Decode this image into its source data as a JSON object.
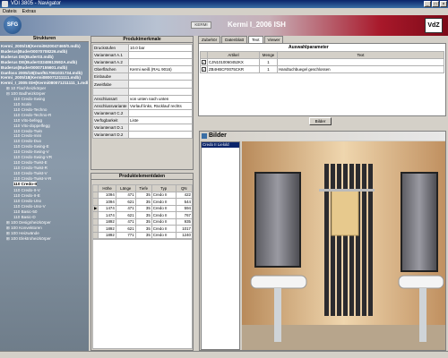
{
  "window": {
    "title": "VDI 3805 - Navigator",
    "controls": [
      "_",
      "□",
      "×"
    ]
  },
  "menu": [
    "Dateis",
    "Extras"
  ],
  "header": {
    "badge": "KERMI",
    "title": "Kermi I_2006 ISH",
    "vdi_logo": "VdZ",
    "logo_text": "SFG"
  },
  "tree": {
    "heading": "Strukturen",
    "items": [
      {
        "label": "Kermi_2005/18(Kermi0620047460/0.mdb)",
        "bold": true
      },
      {
        "label": "Buderus(Buder00070708226.mdb)",
        "bold": true
      },
      {
        "label": "Buderus DE(Buder03.mdb)",
        "bold": true
      },
      {
        "label": "Buderus DE(Buder03248613592A.mdb)",
        "bold": true
      },
      {
        "label": "Buderus(Buder00007155601.mdb)",
        "bold": true
      },
      {
        "label": "Danfoss 2005/18(Danf517061031734.mdb)",
        "bold": true
      },
      {
        "label": "Kermi_2005/18(Kermi080071211111.mdb)",
        "bold": true
      },
      {
        "label": "Kermi_I_2005 ISH(Kermi080071211111_1.mdb)",
        "bold": true
      },
      {
        "label": "⊞ 10 Flachheizkörper",
        "bold": false
      },
      {
        "label": "⊟ 100 Badheizkörper",
        "bold": false
      },
      {
        "label": "110 Credo-Swing",
        "bold": false
      },
      {
        "label": "110 Scalo",
        "bold": false
      },
      {
        "label": "110 Credo-Techno",
        "bold": false
      },
      {
        "label": "110 Credo-Techno-R",
        "bold": false
      },
      {
        "label": "110 Vito-befegg",
        "bold": false
      },
      {
        "label": "110 Vito-doppelfegg",
        "bold": false
      },
      {
        "label": "110 Credo-Twin",
        "bold": false
      },
      {
        "label": "110 Credo-mini",
        "bold": false
      },
      {
        "label": "110 Credo-Duo",
        "bold": false
      },
      {
        "label": "110 Credo-Swing-E",
        "bold": false
      },
      {
        "label": "110 Credo-Swing-V",
        "bold": false
      },
      {
        "label": "110 Credo-Swing-VR",
        "bold": false
      },
      {
        "label": "110 Credo-Twist-E",
        "bold": false
      },
      {
        "label": "110 Credo-Twist-R",
        "bold": false
      },
      {
        "label": "110 Credo-Twist-V",
        "bold": false
      },
      {
        "label": "110 Credo-Twist-V-R",
        "bold": false
      },
      {
        "label": "110 Credo-II",
        "selected": true
      },
      {
        "label": "110 Credo-II-V",
        "bold": false
      },
      {
        "label": "110 Credo-II-E",
        "bold": false
      },
      {
        "label": "110 Credo-Uno",
        "bold": false
      },
      {
        "label": "110 Credo-Uno-V",
        "bold": false
      },
      {
        "label": "110 Basic-50",
        "bold": false
      },
      {
        "label": "110 Basic-D",
        "bold": false
      },
      {
        "label": "⊞ 100 Designheizkörper",
        "bold": false
      },
      {
        "label": "⊞ 100 Konvektoren",
        "bold": false
      },
      {
        "label": "⊞ 100 Heizwände",
        "bold": false
      },
      {
        "label": "⊞ 100 Elektroheizkörper",
        "bold": false
      }
    ]
  },
  "props": {
    "heading": "Produktmerkmale",
    "rows": [
      [
        "Druckstufen",
        "10.0 bar"
      ],
      [
        "Variantenart A.1",
        ""
      ],
      [
        "Variantenart A.2",
        ""
      ],
      [
        "Oberflächen",
        "Kermi weiß (RAL 9016)"
      ],
      [
        "Einbaube",
        ""
      ],
      [
        "Zweitfabe",
        ""
      ],
      [
        "",
        ""
      ],
      [
        "Anschlussart",
        "von unten nach unten"
      ],
      [
        "Anschlussvariante",
        "Vorlauf links, Rücklauf rechts"
      ],
      [
        "Variantenart C.2",
        ""
      ],
      [
        "Verfügbarkeit",
        "Liste"
      ],
      [
        "Variantenart D.1",
        ""
      ],
      [
        "Variantenart D.2",
        ""
      ]
    ]
  },
  "elements": {
    "heading": "Produktelementdaten",
    "columns": [
      "Höhe",
      "Länge",
      "Tiefe",
      "Typ",
      "QN"
    ],
    "rows": [
      {
        "mark": "",
        "cells": [
          "1094",
          "471",
          "35",
          "Credo II",
          "422"
        ]
      },
      {
        "mark": "",
        "cells": [
          "1094",
          "621",
          "35",
          "Credo II",
          "544"
        ]
      },
      {
        "mark": "▶",
        "cells": [
          "1474",
          "471",
          "35",
          "Credo II",
          "594"
        ]
      },
      {
        "mark": "",
        "cells": [
          "1474",
          "621",
          "35",
          "Credo II",
          "767"
        ]
      },
      {
        "mark": "",
        "cells": [
          "1892",
          "471",
          "35",
          "Credo II",
          "935"
        ]
      },
      {
        "mark": "",
        "cells": [
          "1892",
          "621",
          "35",
          "Credo II",
          "1017"
        ]
      },
      {
        "mark": "",
        "cells": [
          "1892",
          "771",
          "35",
          "Credo II",
          "1240"
        ]
      }
    ]
  },
  "tabs": [
    {
      "label": "Zubehör",
      "active": false
    },
    {
      "label": "Datenblatt",
      "active": false
    },
    {
      "label": "Text",
      "active": true
    },
    {
      "label": "Viewer",
      "active": false
    }
  ],
  "params": {
    "heading": "Auswahlparameter",
    "columns": [
      "",
      "Artikel",
      "Menge",
      "Text"
    ],
    "rows": [
      {
        "checked": true,
        "cells": [
          "CJN1010060452KX",
          "1",
          ""
        ]
      },
      {
        "checked": true,
        "cells": [
          "ZB4HBCF0075CKR",
          "1",
          "Handtuchbuegel geschlossen"
        ]
      }
    ],
    "button": "Bilder"
  },
  "bilder": {
    "title": "Bilder",
    "items": [
      "Credo II Lielold"
    ]
  },
  "colors": {
    "accent": "#0a246a",
    "brand_red": "#a8182a",
    "tree_bg": "#7d8fa3"
  }
}
